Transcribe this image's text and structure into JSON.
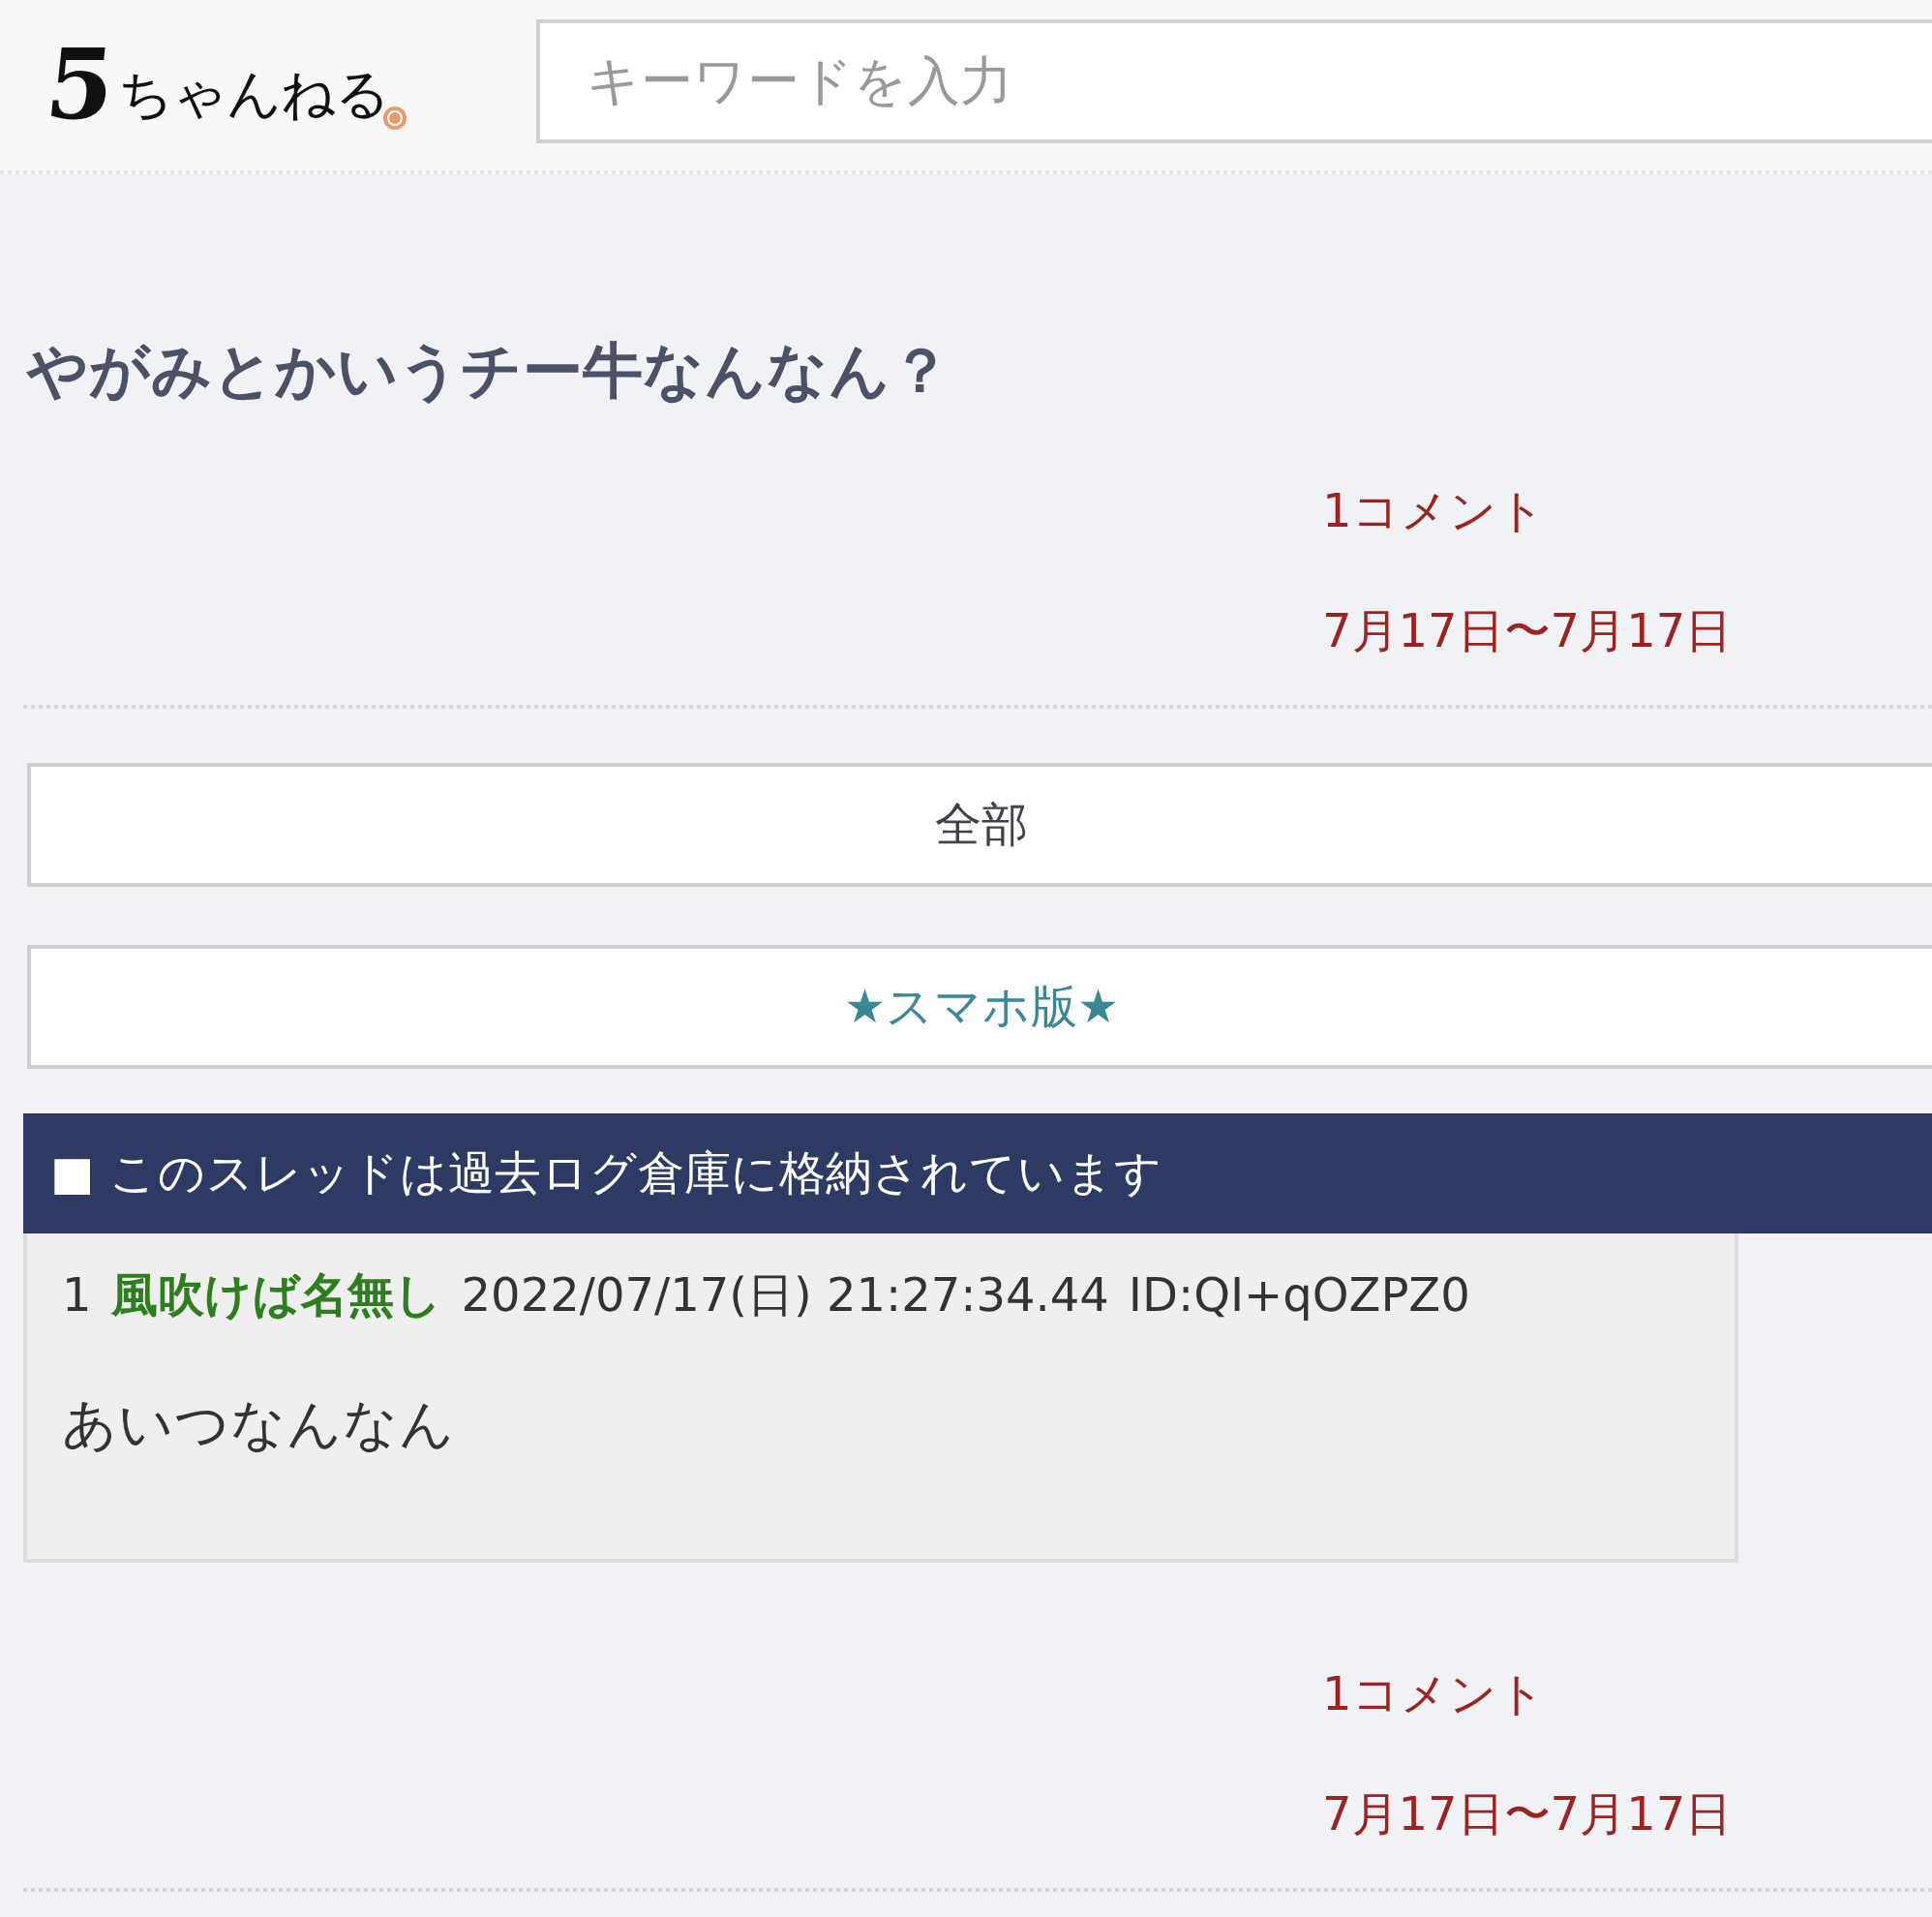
{
  "header": {
    "logo": {
      "mark": "5",
      "text": "ちゃんねる"
    },
    "search": {
      "placeholder": "キーワードを入力"
    }
  },
  "thread": {
    "title": "やがみとかいうチー牛なんなん？",
    "meta_top": {
      "comments": "1コメント",
      "date_range": "7月17日〜7月17日"
    },
    "buttons": [
      {
        "label": "全部",
        "kind": "plain"
      },
      {
        "label": "★スマホ版★",
        "kind": "link"
      }
    ],
    "archive_notice": "■ このスレッドは過去ログ倉庫に格納されています",
    "posts": [
      {
        "number": "1",
        "name": "風吹けば名無し",
        "datetime": "2022/07/17(日) 21:27:34.44",
        "id": "ID:QI+qOZPZ0",
        "body": "あいつなんなん"
      }
    ],
    "meta_bottom": {
      "comments": "1コメント",
      "date_range": "7月17日〜7月17日"
    }
  }
}
